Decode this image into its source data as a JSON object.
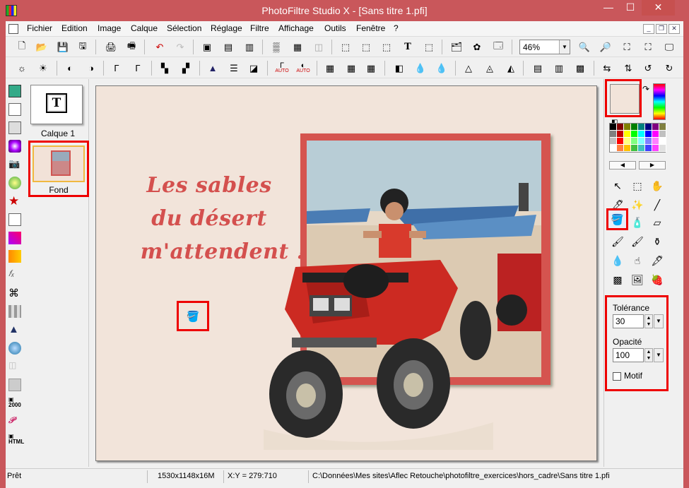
{
  "window": {
    "title": "PhotoFiltre Studio X - [Sans titre 1.pfi]",
    "controls": {
      "minimize": "—",
      "maximize": "☐",
      "close": "✕"
    }
  },
  "menubar": {
    "items": [
      "Fichier",
      "Edition",
      "Image",
      "Calque",
      "Sélection",
      "Réglage",
      "Filtre",
      "Affichage",
      "Outils",
      "Fenêtre",
      "?"
    ],
    "mdi": {
      "minimize": "_",
      "restore": "❐",
      "close": "✕"
    }
  },
  "toolbar": {
    "zoom": "46%",
    "auto_labels": [
      "AUTO",
      "AUTO"
    ]
  },
  "layers": {
    "items": [
      {
        "label": "Calque 1",
        "glyph": "T"
      },
      {
        "label": "Fond"
      }
    ]
  },
  "canvas": {
    "background": "#f2e4da",
    "text_color": "#d4504e",
    "lines": [
      "Les sables",
      "du désert",
      "m'attendent !"
    ]
  },
  "tool_options": {
    "tolerance_label": "Tolérance",
    "tolerance_value": "30",
    "opacity_label": "Opacité",
    "opacity_value": "100",
    "motif_label": "Motif"
  },
  "colors": {
    "foreground": "#f2e4da",
    "palette": [
      "#000000",
      "#800000",
      "#808000",
      "#008000",
      "#008080",
      "#000080",
      "#800080",
      "#808040",
      "#808080",
      "#c00000",
      "#ffff00",
      "#00ff00",
      "#00ffff",
      "#0000ff",
      "#ff00ff",
      "#c0c0c0",
      "#c0c0c0",
      "#ff0000",
      "#ffff80",
      "#80ff80",
      "#80ffff",
      "#8080ff",
      "#ff80ff",
      "#ffffff",
      "#ffffff",
      "#ff8040",
      "#ffc000",
      "#40c040",
      "#40c0c0",
      "#4040ff",
      "#ff40ff",
      "#e0e0e0"
    ]
  },
  "statusbar": {
    "state": "Prêt",
    "size": "1530x1148x16M",
    "coords": "X:Y = 279:710",
    "path": "C:\\Données\\Mes sites\\Aflec Retouche\\photofiltre_exercices\\hors_cadre\\Sans titre 1.pfi"
  }
}
